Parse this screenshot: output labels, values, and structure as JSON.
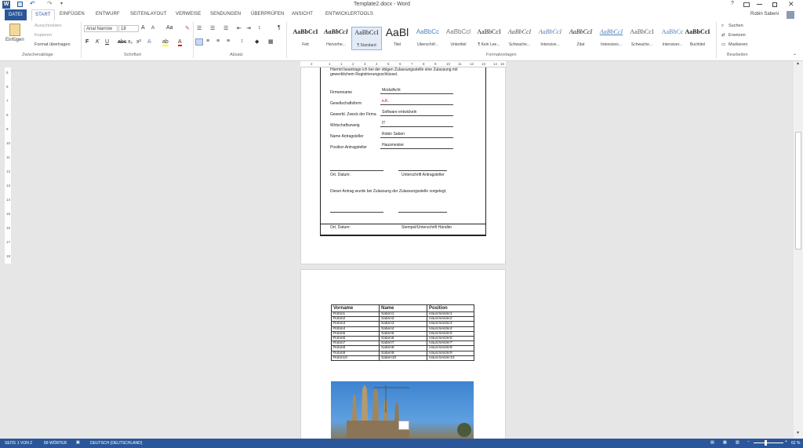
{
  "window": {
    "title": "Template2.docx - Word",
    "help": "?",
    "user": "Robin Sabeni"
  },
  "tabs": [
    {
      "label": "DATEI"
    },
    {
      "label": "START"
    },
    {
      "label": "EINFÜGEN"
    },
    {
      "label": "ENTWURF"
    },
    {
      "label": "SEITENLAYOUT"
    },
    {
      "label": "VERWEISE"
    },
    {
      "label": "SENDUNGEN"
    },
    {
      "label": "ÜBERPRÜFEN"
    },
    {
      "label": "ANSICHT"
    },
    {
      "label": "ENTWICKLERTOOLS"
    }
  ],
  "clipboard": {
    "paste": "Einfügen",
    "cut": "Ausschneiden",
    "copy": "Kopieren",
    "format_painter": "Format übertragen",
    "label": "Zwischenablage"
  },
  "font": {
    "name": "Arial Narrow",
    "size": "18",
    "label": "Schriftart",
    "aa": "Aa"
  },
  "paragraph": {
    "label": "Absatz"
  },
  "styles": {
    "label": "Formatvorlagen",
    "items": [
      {
        "sample": "AaBbCcI",
        "name": "Fett"
      },
      {
        "sample": "AaBbCcI",
        "name": "Hervorhe..."
      },
      {
        "sample": "AaBbCcI",
        "name": "¶ Standard"
      },
      {
        "sample": "AaBl",
        "name": "Titel"
      },
      {
        "sample": "AaBbCc",
        "name": "Überschrif..."
      },
      {
        "sample": "AaBbCcl",
        "name": "Untertitel"
      },
      {
        "sample": "AaBbCcI",
        "name": "¶ Kein Lee..."
      },
      {
        "sample": "AaBbCcI",
        "name": "Schwache..."
      },
      {
        "sample": "AaBbCcI",
        "name": "Intensive..."
      },
      {
        "sample": "AaBbCcI",
        "name": "Zitat"
      },
      {
        "sample": "AaBbCcI",
        "name": "Intensives..."
      },
      {
        "sample": "AaBbCcI",
        "name": "Schwache..."
      },
      {
        "sample": "AaBbCc",
        "name": "Intensiver..."
      },
      {
        "sample": "AaBbCcI",
        "name": "Buchtitel"
      }
    ]
  },
  "editing": {
    "find": "Suchen",
    "replace": "Ersetzen",
    "select": "Markieren",
    "label": "Bearbeiten"
  },
  "page1": {
    "intro1": "Hiermit beantrage ich bei der obigen Zulassungsstelle eine Zulassung mit",
    "intro2": "gewerblichem Registrierungsschlüssel.",
    "fields": [
      {
        "label": "Firmenname",
        "value": "ModulAcht"
      },
      {
        "label": "Gesellschaftsform",
        "value": "e.K."
      },
      {
        "label": "Gewerbl. Zweck der Firma",
        "value": "Software entwickeln"
      },
      {
        "label": "Wirtschaftszweig",
        "value": "IT"
      },
      {
        "label": "Name Antragsteller",
        "value": "Robin Saberi"
      },
      {
        "label": "Position Antragsteller",
        "value": "Hausmeister"
      }
    ],
    "sig1_left": "Ort, Datum:",
    "sig1_right": "Unterschrift Antragsteller",
    "note": "Dieser Antrag wurde bei Zulassung der Zulassungsstelle vorgelegt.",
    "sig2_left": "Ort, Datum:",
    "sig2_right": "Stempel/Unterschrift Händler"
  },
  "table": {
    "headers": [
      "Vorname",
      "Name",
      "Position"
    ],
    "rows": [
      [
        "Robin1",
        "Saberi1",
        "Hausmeister1"
      ],
      [
        "Robin2",
        "Saberi2",
        "Hausmeister2"
      ],
      [
        "Robin3",
        "Saberi3",
        "Hausmeister3"
      ],
      [
        "Robin4",
        "Saberi4",
        "Hausmeister4"
      ],
      [
        "Robin5",
        "Saberi5",
        "Hausmeister5"
      ],
      [
        "Robin6",
        "Saberi6",
        "Hausmeister6"
      ],
      [
        "Robin7",
        "Saberi7",
        "Hausmeister7"
      ],
      [
        "Robin8",
        "Saberi8",
        "Hausmeister8"
      ],
      [
        "Robin9",
        "Saberi9",
        "Hausmeister9"
      ],
      [
        "Robin10",
        "Saberi10",
        "Hausmeister10"
      ]
    ]
  },
  "ruler": {
    "h": [
      "2",
      "1",
      "1",
      "2",
      "3",
      "4",
      "5",
      "6",
      "7",
      "8",
      "9",
      "10",
      "11",
      "12",
      "13",
      "14",
      "16"
    ],
    "v": [
      "5",
      "6",
      "7",
      "8",
      "9",
      "10",
      "11",
      "12",
      "13",
      "14",
      "15",
      "16",
      "17",
      "18"
    ]
  },
  "status": {
    "page": "SEITE 1 VON 2",
    "words": "89 WÖRTER",
    "lang": "DEUTSCH (DEUTSCHLAND)",
    "zoom": "62 %"
  },
  "colors": {
    "accent": "#2b579a"
  }
}
